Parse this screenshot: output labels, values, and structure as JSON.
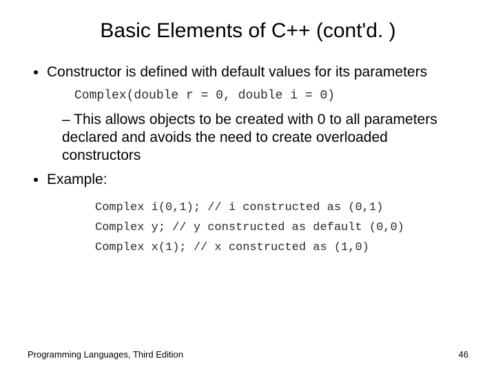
{
  "title": "Basic Elements of C++ (cont'd. )",
  "bullets": {
    "b1": "Constructor is defined with default values for its parameters",
    "code1": "Complex(double r = 0, double i = 0)",
    "b1_sub": "This allows objects to be created with 0 to all parameters declared and avoids the need to create overloaded constructors",
    "b2": "Example:",
    "code2_l1": "Complex i(0,1); // i constructed as (0,1)",
    "code2_l2": "Complex y; // y constructed as default (0,0)",
    "code2_l3": "Complex x(1); // x constructed as (1,0)"
  },
  "footer": {
    "left": "Programming Languages, Third Edition",
    "right": "46"
  }
}
